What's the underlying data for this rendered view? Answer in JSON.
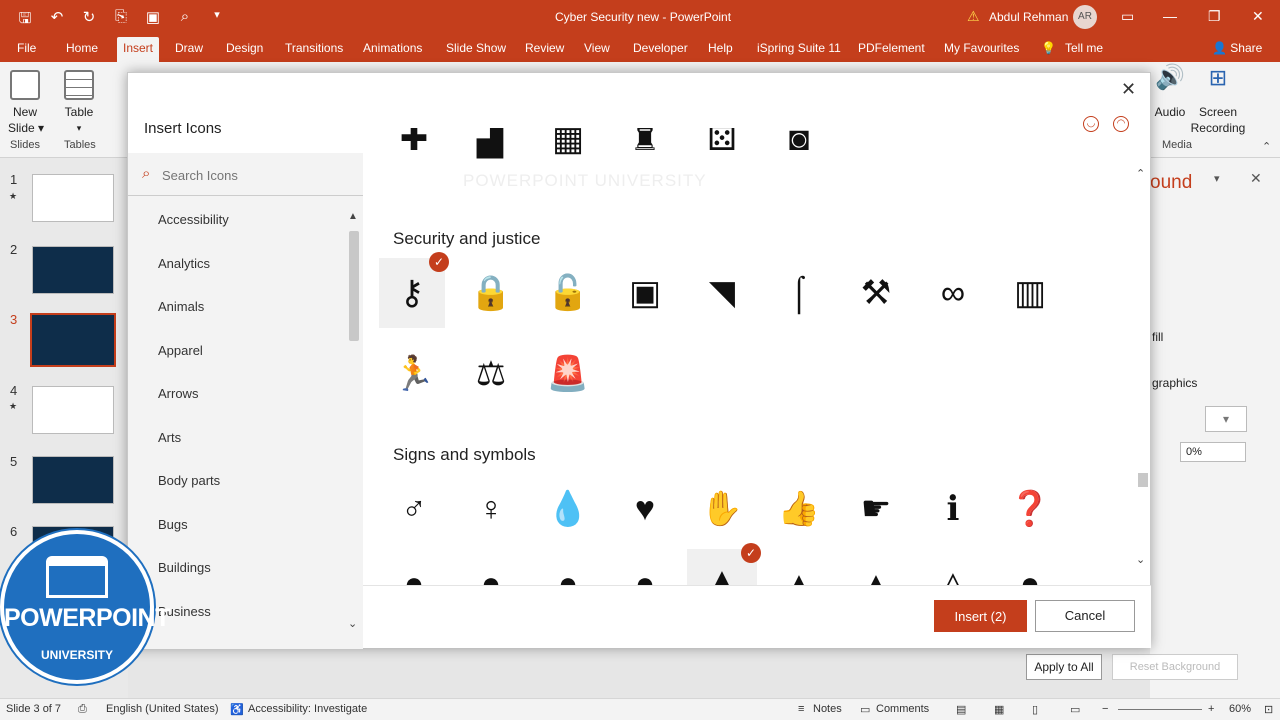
{
  "window": {
    "title": "Cyber Security new  -  PowerPoint",
    "user": "Abdul Rehman",
    "avatar_initials": "AR",
    "accent_color": "#c43e1c"
  },
  "tabs": [
    "File",
    "Home",
    "Insert",
    "Draw",
    "Design",
    "Transitions",
    "Animations",
    "Slide Show",
    "Review",
    "View",
    "Developer",
    "Help",
    "iSpring Suite 11",
    "PDFelement",
    "My Favourites",
    "Tell me",
    "Share"
  ],
  "active_tab": "Insert",
  "ribbon": {
    "new_slide": "New\nSlide",
    "table": "Table",
    "audio": "Audio",
    "screen_recording": "Screen\nRecording",
    "group_slides": "Slides",
    "group_tables": "Tables",
    "group_media": "Media"
  },
  "slides": [
    {
      "num": "1",
      "star": "★"
    },
    {
      "num": "2",
      "star": ""
    },
    {
      "num": "3",
      "star": ""
    },
    {
      "num": "4",
      "star": "★"
    },
    {
      "num": "5",
      "star": ""
    },
    {
      "num": "6",
      "star": ""
    }
  ],
  "right_pane": {
    "title_partial": "ound",
    "fill": "fill",
    "graphics": "graphics",
    "transparency": "0%",
    "apply_all": "Apply to All",
    "reset_background": "Reset Background"
  },
  "dialog": {
    "title": "Insert Icons",
    "search_placeholder": "Search Icons",
    "categories": [
      "Accessibility",
      "Analytics",
      "Animals",
      "Apparel",
      "Arrows",
      "Arts",
      "Body parts",
      "Bugs",
      "Buildings",
      "Business"
    ],
    "watermark": "POWERPOINT UNIVERSITY",
    "sections": [
      {
        "title": "Security and justice",
        "icons": [
          "key-icon",
          "padlock-locked-icon",
          "padlock-unlocked-icon",
          "safe-icon",
          "security-camera-icon",
          "street-light-icon",
          "gavel-icon",
          "handcuffs-icon",
          "jail-icon",
          "running-man-icon",
          "scales-of-justice-icon",
          "siren-icon"
        ]
      },
      {
        "title": "Signs and symbols",
        "icons": [
          "male-symbol-icon",
          "female-symbol-icon",
          "water-drop-icon",
          "heart-icon",
          "raised-hand-icon",
          "thumbs-up-icon",
          "pointing-hand-icon",
          "information-icon",
          "question-mark-icon"
        ]
      }
    ],
    "selected_icon": "key-icon",
    "insert_label": "Insert (2)",
    "cancel_label": "Cancel"
  },
  "status": {
    "slide": "Slide 3 of 7",
    "language": "English (United States)",
    "accessibility": "Accessibility: Investigate",
    "notes": "Notes",
    "comments": "Comments",
    "zoom": "60%"
  },
  "logo": {
    "text": "POWERPOINT",
    "sub": "UNIVERSITY"
  }
}
